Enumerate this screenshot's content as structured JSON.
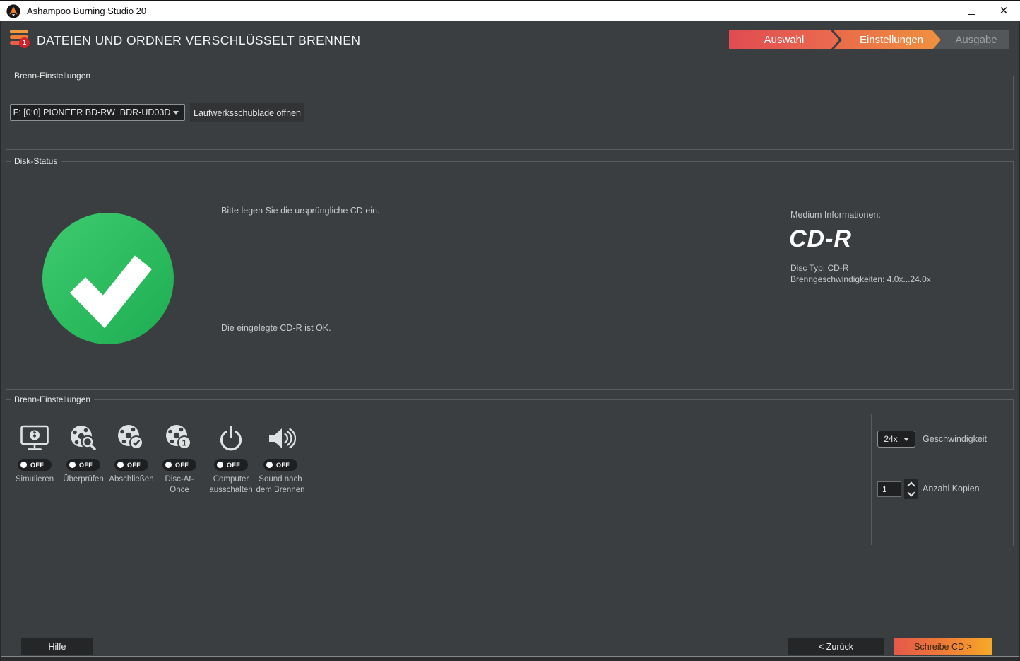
{
  "window": {
    "title": "Ashampoo Burning Studio 20"
  },
  "header": {
    "title": "DATEIEN UND ORDNER VERSCHLÜSSELT BRENNEN",
    "menu_badge": "1",
    "steps": [
      {
        "label": "Auswahl"
      },
      {
        "label": "Einstellungen"
      },
      {
        "label": "Ausgabe"
      }
    ]
  },
  "burn_settings_top": {
    "legend": "Brenn-Einstellungen",
    "drive_select_value": "F: [0:0] PIONEER BD-RW  BDR-UD03D",
    "open_tray_button": "Laufwerksschublade öffnen"
  },
  "disk_status": {
    "legend": "Disk-Status",
    "message_top": "Bitte legen Sie die ursprüngliche CD ein.",
    "message_bottom": "Die eingelegte CD-R ist OK.",
    "medium_info": {
      "heading": "Medium Informationen:",
      "medium": "CD-R",
      "disc_type": "Disc Typ: CD-R",
      "speeds": "Brenngeschwindigkeiten: 4.0x...24.0x"
    }
  },
  "burn_settings_bottom": {
    "legend": "Brenn-Einstellungen",
    "toggles": [
      {
        "label": "Simulieren",
        "state": "OFF"
      },
      {
        "label": "Überprüfen",
        "state": "OFF"
      },
      {
        "label": "Abschließen",
        "state": "OFF"
      },
      {
        "label": "Disc-At-Once",
        "state": "OFF"
      },
      {
        "label": "Computer ausschalten",
        "state": "OFF"
      },
      {
        "label": "Sound nach dem Brennen",
        "state": "OFF"
      }
    ],
    "speed": {
      "value": "24x",
      "label": "Geschwindigkeit"
    },
    "copies": {
      "value": "1",
      "label": "Anzahl Kopien"
    }
  },
  "footer": {
    "help_button": "Hilfe",
    "back_button": "< Zurück",
    "write_button": "Schreibe CD >"
  },
  "colors": {
    "app_background": "#3b3e40",
    "success_green_start": "#3ecb70",
    "success_green_end": "#1ead52",
    "step_done_red": "#e04b52",
    "step_active_orange": "#f0913e",
    "step_upcoming_gray": "#54575a",
    "badge_red": "#d42229",
    "write_button_gradient_start": "#e4584a",
    "write_button_gradient_end": "#f7a928"
  }
}
